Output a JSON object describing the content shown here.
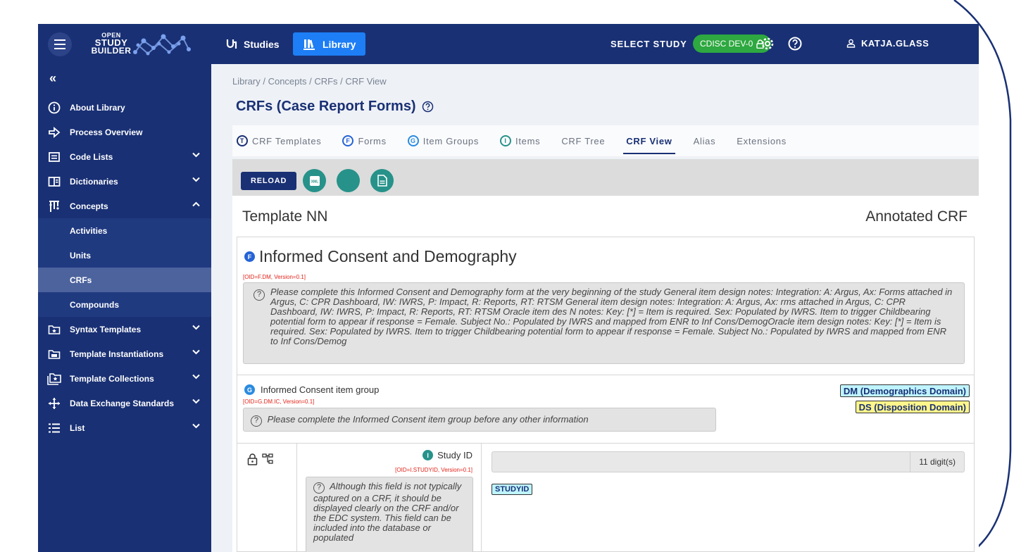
{
  "topbar": {
    "logo_lines": [
      "OPEN",
      "STUDY",
      "BUILDER"
    ],
    "nav_studies": "Studies",
    "nav_library": "Library",
    "select_study": "SELECT STUDY",
    "study_badge": "CDISC DEV-0",
    "user": "KATJA.GLASS"
  },
  "sidebar": {
    "collapse": "«",
    "items": [
      {
        "label": "About Library",
        "icon": "info-icon"
      },
      {
        "label": "Process Overview",
        "icon": "arrow-right-icon"
      },
      {
        "label": "Code Lists",
        "icon": "list-box-icon",
        "chevron": "down"
      },
      {
        "label": "Dictionaries",
        "icon": "book-icon",
        "chevron": "down"
      },
      {
        "label": "Concepts",
        "icon": "concepts-icon",
        "chevron": "up"
      },
      {
        "label": "Activities",
        "sub": true
      },
      {
        "label": "Units",
        "sub": true
      },
      {
        "label": "CRFs",
        "sub": true,
        "active": true
      },
      {
        "label": "Compounds",
        "sub": true
      },
      {
        "label": "Syntax Templates",
        "icon": "template-icon",
        "chevron": "down"
      },
      {
        "label": "Template Instantiations",
        "icon": "template-icon",
        "chevron": "down"
      },
      {
        "label": "Template Collections",
        "icon": "template-collection-icon",
        "chevron": "down"
      },
      {
        "label": "Data Exchange Standards",
        "icon": "exchange-icon",
        "chevron": "down"
      },
      {
        "label": "List",
        "icon": "list-icon",
        "chevron": "down"
      }
    ]
  },
  "breadcrumb": "Library  /  Concepts  /  CRFs  /  CRF View",
  "page_title": "CRFs (Case Report Forms)",
  "tabs": [
    {
      "label": "CRF Templates",
      "letter": "T"
    },
    {
      "label": "Forms",
      "letter": "F"
    },
    {
      "label": "Item Groups",
      "letter": "G"
    },
    {
      "label": "Items",
      "letter": "I"
    },
    {
      "label": "CRF Tree",
      "letter": ""
    },
    {
      "label": "CRF View",
      "letter": "",
      "active": true
    },
    {
      "label": "Alias",
      "letter": ""
    },
    {
      "label": "Extensions",
      "letter": ""
    }
  ],
  "toolbar": {
    "reload": "RELOAD",
    "xml_icon_text": "XML"
  },
  "crf": {
    "template_title": "Template NN",
    "annotated_title": "Annotated CRF",
    "form": {
      "badge": "F",
      "title": "Informed Consent and Demography",
      "oid": "[OID=F.DM, Version=0.1]",
      "note": "Please complete this Informed Consent and Demography form at the very beginning of the study General item design notes: Integration: A: Argus, Ax: Forms attached in Argus, C: CPR Dashboard, IW: IWRS, P: Impact, R: Reports, RT: RTSM General item design notes: Integration: A: Argus, Ax: rms attached in Argus, C: CPR Dashboard, IW: IWRS, P: Impact, R: Reports, RT: RTSM Oracle item des N notes: Key: [*] = Item is required. Sex: Populated by IWRS. Item to trigger Childbearing potential form to appear if response = Female. Subject No.: Populated by IWRS and mapped from ENR to Inf Cons/DemogOracle item design notes: Key: [*] = Item is required. Sex: Populated by IWRS. Item to trigger Childbearing potential form to appear if response = Female. Subject No.: Populated by IWRS and mapped from ENR to Inf Cons/Demog"
    },
    "group": {
      "badge": "G",
      "title": "Informed Consent item group",
      "oid": "[OID=G.DM.IC, Version=0.1]",
      "note": "Please complete the Informed Consent item group before any other information",
      "domains": [
        "DM (Demographics Domain)",
        "DS (Disposition Domain)"
      ]
    },
    "item": {
      "badge": "I",
      "title": "Study ID",
      "oid": "[OID=I.STUDYID, Version=0.1]",
      "note": "Although this field is not typically captured on a CRF, it should be displayed clearly on the CRF and/or the EDC system. This field can be included into the database or populated",
      "length": "11 digit(s)",
      "sdtm": "STUDYID"
    }
  },
  "colors": {
    "navy": "#193074",
    "library_blue": "#1d7ef5",
    "study_green": "#2ea840",
    "teal": "#27928a",
    "oid_red": "#e2231a",
    "dm_cyan": "#bff4ff",
    "ds_yellow": "#fff58a"
  }
}
